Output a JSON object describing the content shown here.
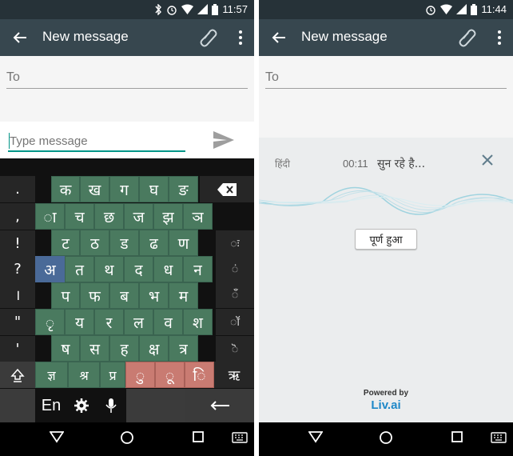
{
  "left": {
    "status": {
      "time": "11:57"
    },
    "toolbar": {
      "title": "New message"
    },
    "to_label": "To",
    "compose": {
      "placeholder": "Type message"
    },
    "keyboard": {
      "side_left": [
        ".",
        ",",
        "!",
        "?",
        "।",
        "\"",
        "'"
      ],
      "side_right": [
        "ः",
        "ं",
        "ँ",
        "ॅ",
        "ॉ",
        "ॆ"
      ],
      "row1": [
        "क",
        "ख",
        "ग",
        "घ",
        "ङ"
      ],
      "row2": [
        "ा",
        "च",
        "छ",
        "ज",
        "झ",
        "ञ"
      ],
      "row3": [
        "ट",
        "ठ",
        "ड",
        "ढ",
        "ण"
      ],
      "row4": [
        "अ",
        "त",
        "थ",
        "द",
        "ध",
        "न"
      ],
      "row5": [
        "प",
        "फ",
        "ब",
        "भ",
        "म"
      ],
      "row6": [
        "ृ",
        "य",
        "र",
        "ल",
        "व",
        "श"
      ],
      "row7": [
        "ष",
        "स",
        "ह",
        "क्ष",
        "त्र"
      ],
      "row8_green": [
        "ज्ञ",
        "श्र",
        "प्र"
      ],
      "row8_red": [
        "ु",
        "ू",
        "ि"
      ],
      "row8_right": "ऋ",
      "bottom": {
        "lang": "En"
      }
    }
  },
  "right": {
    "status": {
      "time": "11:44"
    },
    "toolbar": {
      "title": "New message"
    },
    "to_label": "To",
    "voice": {
      "language": "हिंदी",
      "timer": "00:11",
      "status": "सुन रहे है...",
      "done": "पूर्ण हुआ",
      "powered_by": "Powered by",
      "brand": "Liv.ai"
    }
  },
  "colors": {
    "statusbar": "#263238",
    "toolbar": "#37474f",
    "accent": "#009688",
    "key_green": "#4a7a5f",
    "key_red": "#c97b72",
    "key_blue": "#4a6a98"
  }
}
